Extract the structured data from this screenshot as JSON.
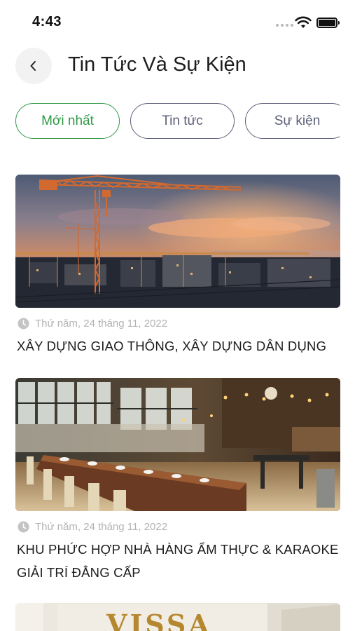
{
  "status_bar": {
    "time": "4:43"
  },
  "header": {
    "title": "Tin Tức Và Sự Kiện"
  },
  "tabs": [
    {
      "label": "Mới nhất",
      "active": true
    },
    {
      "label": "Tin tức",
      "active": false
    },
    {
      "label": "Sự kiện",
      "active": false
    }
  ],
  "articles": [
    {
      "date": "Thứ năm, 24 tháng 11, 2022",
      "title": "XÂY DỰNG GIAO THÔNG, XÂY DỰNG DÂN DỤNG",
      "image": "construction-crane-sunset"
    },
    {
      "date": "Thứ năm, 24 tháng 11, 2022",
      "title": "KHU PHỨC HỢP NHÀ HÀNG ẨM THỰC & KARAOKE GIẢI TRÍ ĐẲNG CẤP",
      "image": "restaurant-interior"
    },
    {
      "image_text": "VISSA",
      "image": "hotel-signage"
    }
  ],
  "colors": {
    "accent_green": "#2f9a45",
    "tab_border": "#5c5f79",
    "date_gray": "#b3b3b3"
  },
  "icons": {
    "back": "chevron-left-icon",
    "date": "clock-icon"
  }
}
